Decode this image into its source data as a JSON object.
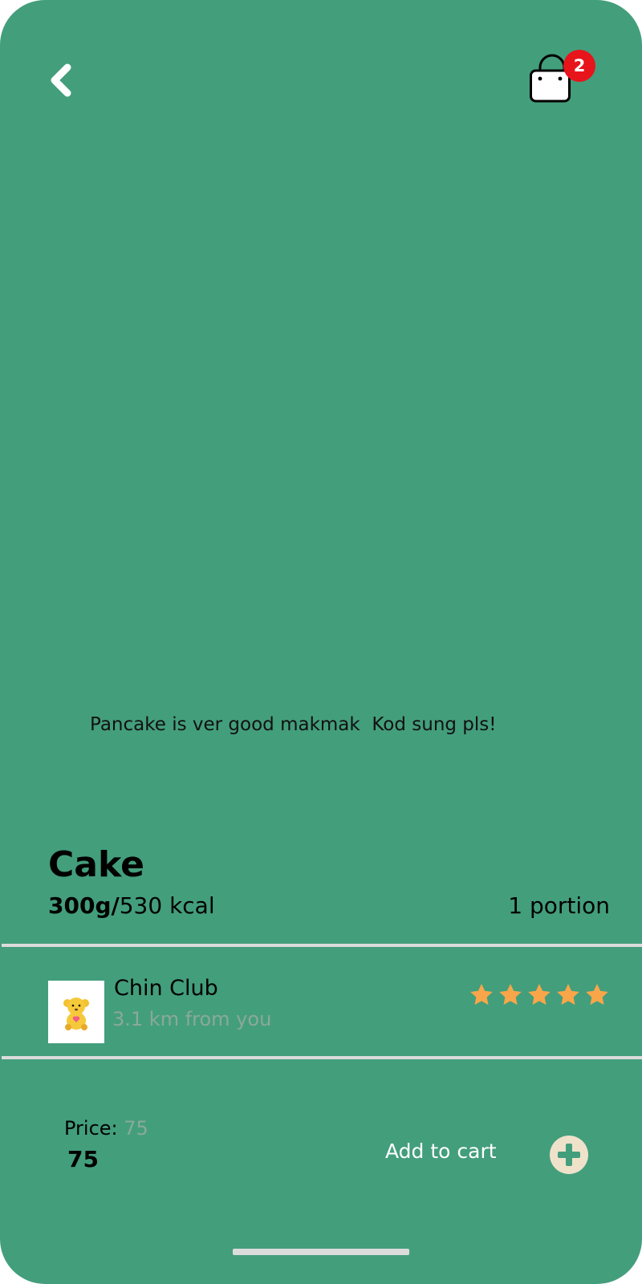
{
  "header": {
    "back_icon": "chevron-left-icon",
    "bag_icon": "shopping-bag-icon",
    "cart_count": "2",
    "badge_color": "#e8141b"
  },
  "product": {
    "description": "Pancake is ver good makmak  Kod sung pls!",
    "title": "Cake",
    "weight": "300g/",
    "calories": "530 kcal",
    "portion": "1 portion"
  },
  "vendor": {
    "logo_icon": "teddy-bear-icon",
    "name": "Chin Club",
    "distance": "3.1 km from you",
    "rating": 5,
    "rating_max": 5,
    "star_color": "#f9a64a"
  },
  "purchase": {
    "price_label": "Price: ",
    "price_label_value": "75",
    "price_value": "75",
    "add_to_cart_label": "Add to cart",
    "add_icon": "plus-circle-icon"
  },
  "colors": {
    "background": "#439e7c",
    "divider": "#dcdcdc",
    "add_button": "#efe2ca"
  }
}
